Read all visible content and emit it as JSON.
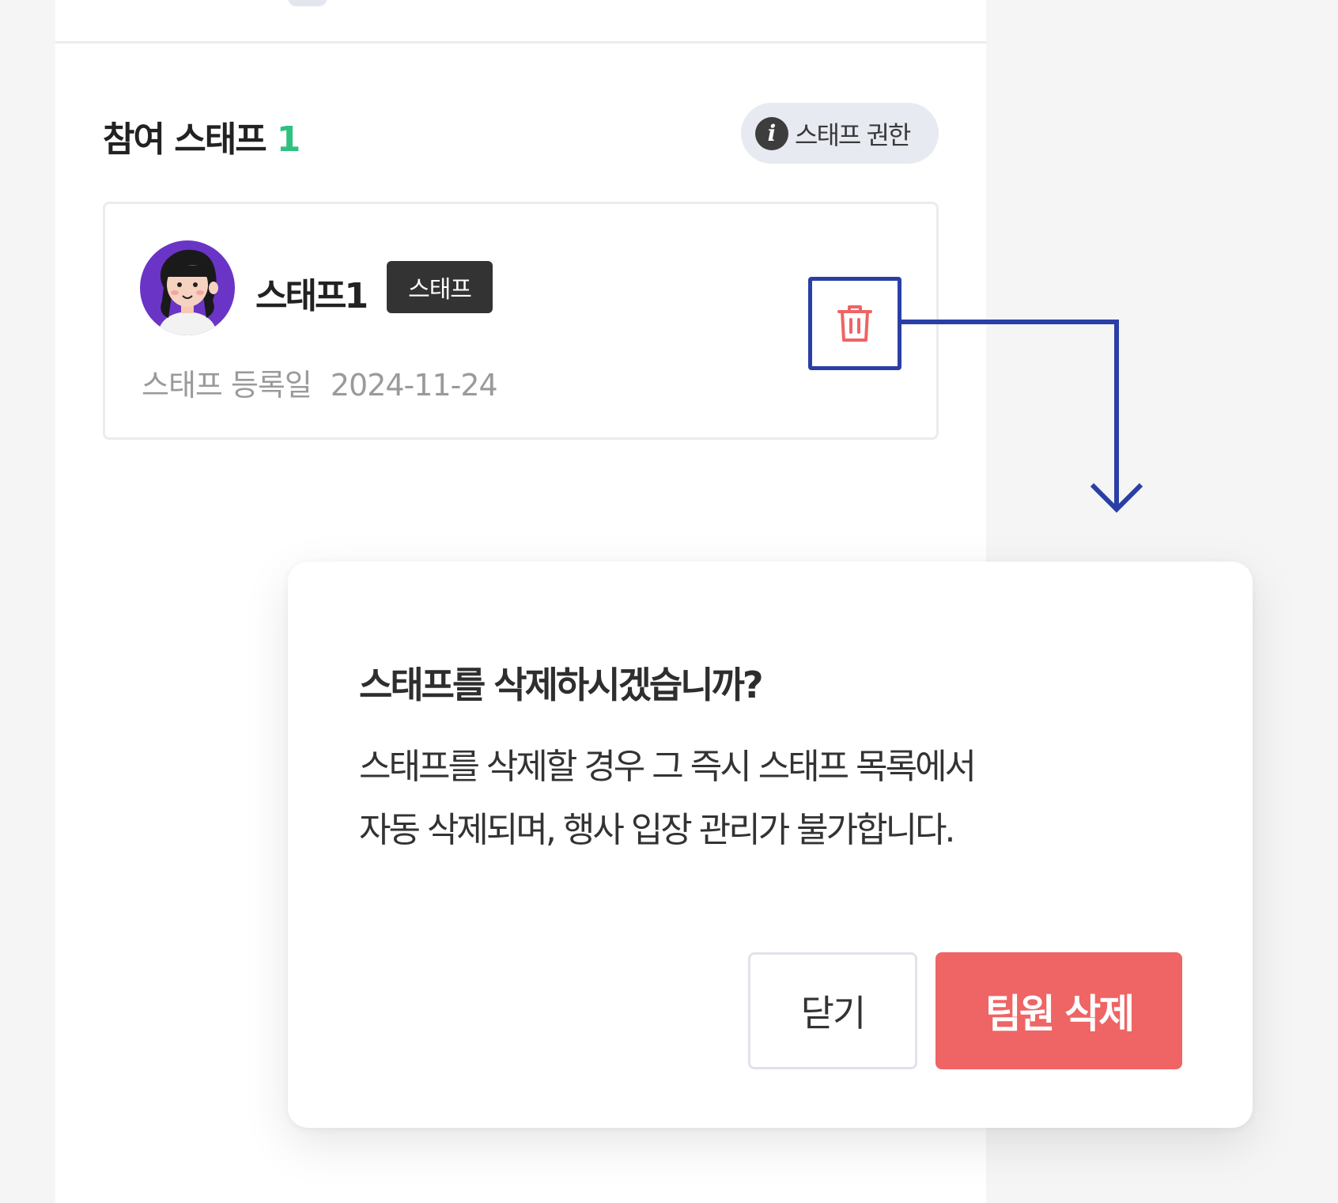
{
  "staff_section": {
    "title": "참여 스태프",
    "count": "1",
    "permission_chip": {
      "icon": "info-icon",
      "label": "스태프 권한"
    }
  },
  "staff_card": {
    "name": "스태프1",
    "role_badge": "스태프",
    "registered_label": "스태프 등록일",
    "registered_date": "2024-11-24",
    "delete_icon": "trash-icon"
  },
  "modal": {
    "title": "스태프를 삭제하시겠습니까?",
    "body_lines": [
      "스태프를 삭제할 경우 그 즉시 스태프 목록에서",
      "자동 삭제되며, 행사 입장 관리가 불가합니다."
    ],
    "close_label": "닫기",
    "confirm_label": "팀원 삭제"
  },
  "colors": {
    "accent_green": "#2ec27e",
    "danger_red": "#ef6464",
    "highlight_blue": "#2a3fa5",
    "badge_dark": "#333333"
  }
}
